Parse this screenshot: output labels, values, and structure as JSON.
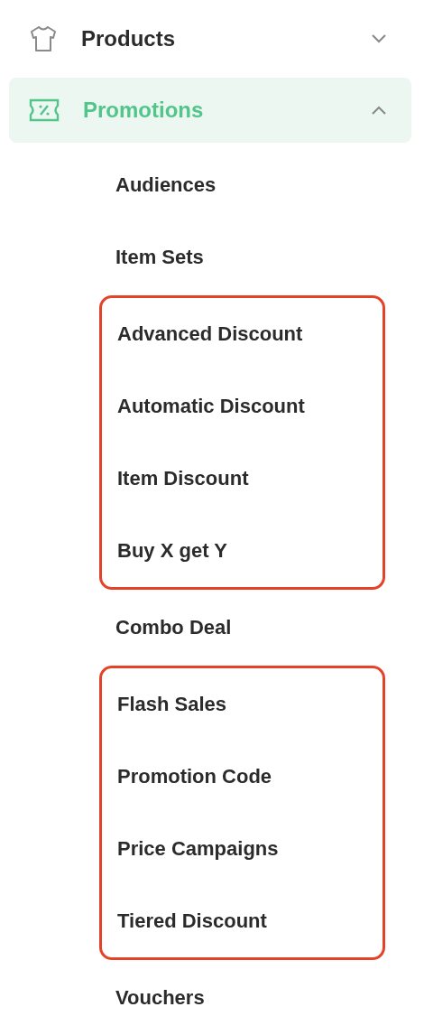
{
  "nav": [
    {
      "label": "Products",
      "selected": false,
      "expanded": false
    },
    {
      "label": "Promotions",
      "selected": true,
      "expanded": true,
      "children": [
        {
          "highlighted": false,
          "items": [
            {
              "label": "Audiences"
            },
            {
              "label": "Item Sets"
            }
          ]
        },
        {
          "highlighted": true,
          "items": [
            {
              "label": "Advanced Discount"
            },
            {
              "label": "Automatic Discount"
            },
            {
              "label": "Item Discount"
            },
            {
              "label": "Buy X get Y"
            }
          ]
        },
        {
          "highlighted": false,
          "items": [
            {
              "label": "Combo Deal"
            }
          ]
        },
        {
          "highlighted": true,
          "items": [
            {
              "label": "Flash Sales"
            },
            {
              "label": "Promotion Code"
            },
            {
              "label": "Price Campaigns"
            },
            {
              "label": "Tiered Discount"
            }
          ]
        },
        {
          "highlighted": false,
          "items": [
            {
              "label": "Vouchers"
            }
          ]
        }
      ]
    }
  ]
}
